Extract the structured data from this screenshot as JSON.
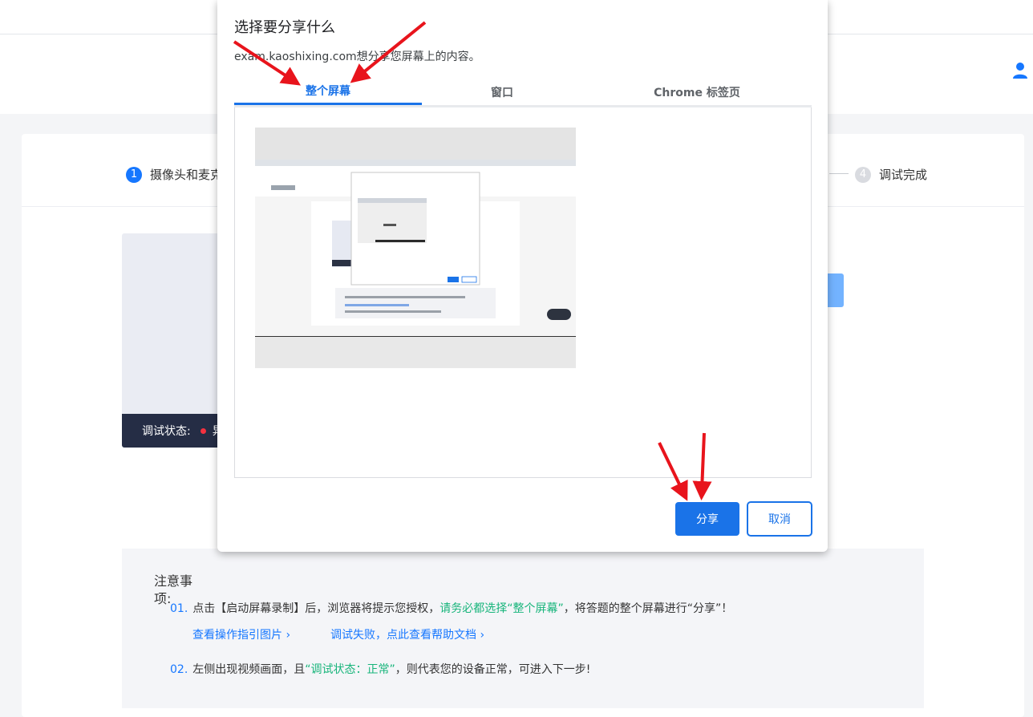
{
  "page": {
    "step1_num": "1",
    "step1_label": "摄像头和麦克",
    "step4_num": "4",
    "step4_label": "调试完成",
    "video_status_label": "调试状态:",
    "video_status_value": "异",
    "notes": {
      "title": "注意事项:",
      "item1_num": "01.",
      "item1_a": "点击【启动屏幕录制】后，浏览器将提示您授权，",
      "item1_b": "请务必都选择“整个屏幕”",
      "item1_c": "，将答题的整个屏幕进行“分享”！",
      "link1": "查看操作指引图片",
      "link2": "调试失败，点此查看帮助文档",
      "item2_num": "02.",
      "item2_a": "左侧出现视频画面，且",
      "item2_b": "“调试状态：正常”",
      "item2_c": "，则代表您的设备正常，可进入下一步!"
    }
  },
  "dialog": {
    "title": "选择要分享什么",
    "subtitle": "exam.kaoshixing.com想分享您屏幕上的内容。",
    "tabs": [
      {
        "label": "整个屏幕"
      },
      {
        "label": "窗口"
      },
      {
        "label": "Chrome 标签页"
      }
    ],
    "share_label": "分享",
    "cancel_label": "取消"
  },
  "colors": {
    "accent": "#1a73e8",
    "arrow": "#e8141c",
    "success_text": "#18b57b"
  }
}
